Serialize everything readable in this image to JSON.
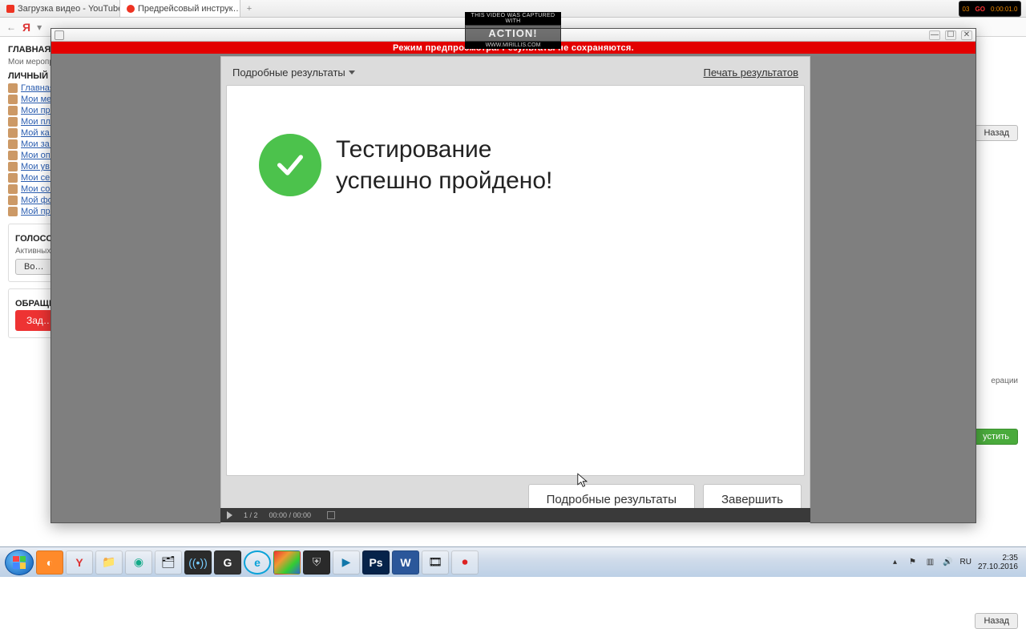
{
  "tabs": {
    "t0": "Загрузка видео - YouTube",
    "t1": "Предрейсовый инструк…"
  },
  "addr": {
    "y": "Я",
    "hint": ""
  },
  "sidebar": {
    "h1": "ГЛАВНАЯ",
    "sub1": "Мои мероприятия",
    "h2": "ЛИЧНЫЙ КАБИНЕТ",
    "links": [
      "Главная",
      "Мои ме…",
      "Мои пр…",
      "Мои пл…",
      "Мой ка…",
      "Мои за…",
      "Мои оп…",
      "Мои ув…",
      "Мои се…",
      "Мои со…",
      "Мой фо…",
      "Мой пр…"
    ],
    "h3": "ГОЛОСОВАНИЯ",
    "votetxt": "Активных…",
    "votebtn": "Во…",
    "h4": "ОБРАЩЕНИЯ",
    "askbtn": "Зад…"
  },
  "right": {
    "back": "Назад",
    "ops": "ерации",
    "run": "устить"
  },
  "modal": {
    "strip": "Режим предпросмотра. Результаты не сохраняются.",
    "drop": "Подробные результаты",
    "print": "Печать результатов",
    "result_l1": "Тестирование",
    "result_l2": "успешно пройдено!",
    "btn_detail": "Подробные результаты",
    "btn_finish": "Завершить"
  },
  "player": {
    "page": "1 / 2",
    "time": "00:00 / 00:00"
  },
  "wm": {
    "top": "THIS VIDEO WAS CAPTURED WITH",
    "logo": "ACTION!",
    "url": "WWW.MIRILLIS.COM"
  },
  "hud": {
    "fps": "03",
    "go": "GO",
    "t": "0:00:01.0"
  },
  "tray": {
    "lang": "RU",
    "time": "2:35",
    "date": "27.10.2016"
  }
}
